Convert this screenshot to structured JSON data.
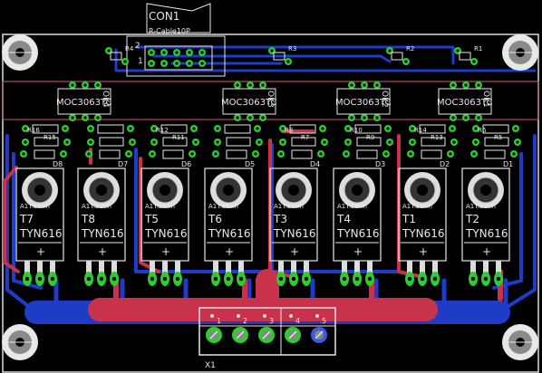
{
  "board": {
    "connector_top": {
      "ref": "CON1",
      "value": "R-Cable10P",
      "pin1": "1",
      "pin2": "2"
    },
    "connector_bottom": {
      "ref": "X1",
      "pins": [
        "1",
        "2",
        "3",
        "4",
        "5"
      ]
    },
    "optos": [
      {
        "ref": "OK4",
        "value": "MOC3063TC"
      },
      {
        "ref": "OK3",
        "value": "MOC3063TC"
      },
      {
        "ref": "OK2",
        "value": "MOC3063TC"
      },
      {
        "ref": "OK1",
        "value": "MOC3063TC"
      }
    ],
    "top_resistors": [
      "R4",
      "R3",
      "R2",
      "R1"
    ],
    "triacs": [
      {
        "ref": "T7",
        "value": "TYN616",
        "hs": "A1"
      },
      {
        "ref": "T8",
        "value": "TYN616",
        "hs": "A1"
      },
      {
        "ref": "T5",
        "value": "TYN616",
        "hs": "A1"
      },
      {
        "ref": "T6",
        "value": "TYN616",
        "hs": "A1"
      },
      {
        "ref": "T3",
        "value": "TYN616",
        "hs": "A1"
      },
      {
        "ref": "T4",
        "value": "TYN616",
        "hs": "A1"
      },
      {
        "ref": "T1",
        "value": "TYN616",
        "hs": "A1"
      },
      {
        "ref": "T2",
        "value": "TYN616",
        "hs": "A1"
      }
    ],
    "heatsink_text": "A1T.5mm",
    "diodes": [
      "D8",
      "D7",
      "D6",
      "D5",
      "D4",
      "D3",
      "D2",
      "D1"
    ],
    "resistors_mid": [
      "R16",
      "R15",
      "R12",
      "R11",
      "R8",
      "R7",
      "R10",
      "R9",
      "R14",
      "R13",
      "R6",
      "R5"
    ],
    "colors": {
      "background": "#000000",
      "top_copper": "#c8324a",
      "bottom_copper": "#1e3cc8",
      "pad": "#2ecc2e",
      "silkscreen": "#e8e8e8",
      "board_outline": "#c86464"
    }
  }
}
